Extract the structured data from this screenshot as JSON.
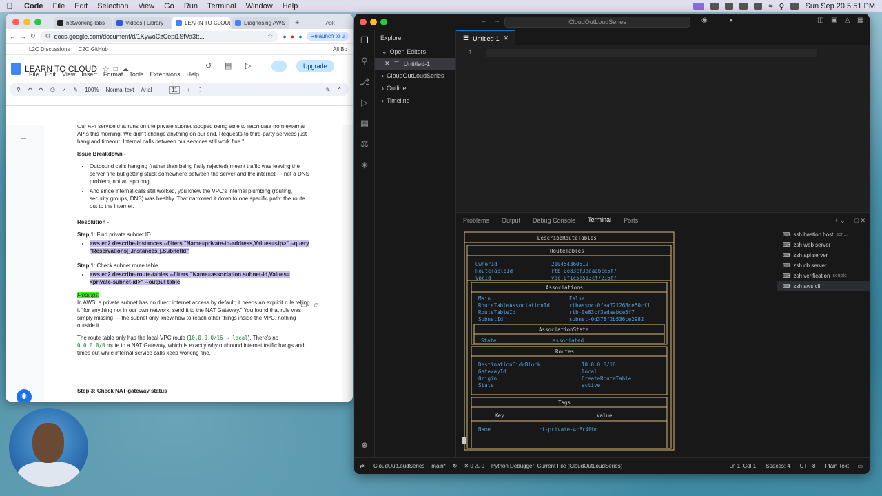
{
  "menubar": {
    "app": "Code",
    "items": [
      "File",
      "Edit",
      "Selection",
      "View",
      "Go",
      "Run",
      "Terminal",
      "Window",
      "Help"
    ],
    "clock": "Sun Sep 20  5:51 PM"
  },
  "chrome": {
    "tabs": [
      {
        "label": "networking-labs",
        "color": "#222222"
      },
      {
        "label": "Videos | Library",
        "color": "#2b5bd7"
      },
      {
        "label": "LEARN TO CLOUD",
        "color": "#4285f4"
      },
      {
        "label": "Diagnosing AWS",
        "color": "#4285f4"
      }
    ],
    "tab_extra": "Ask",
    "url": "docs.google.com/document/d/1KywoCzCepi1SfVa3tt...",
    "relaunch": "Relaunch to u",
    "all_bookmarks": "All Bo",
    "bookmarks": [
      "L2C Discussions",
      "C2C GitHub"
    ]
  },
  "docs": {
    "title": "LEARN TO CLOUD",
    "menus": [
      "File",
      "Edit",
      "View",
      "Insert",
      "Format",
      "Tools",
      "Extensions",
      "Help"
    ],
    "upgrade": "Upgrade",
    "zoom": "100%",
    "style": "Normal text",
    "font": "Arial",
    "font_size": "11",
    "intro": "Our API service that runs on the private subnet stopped being able to fetch data from external APIs this morning. We didn't change anything on our end. Requests to third-party services just hang and timeout. Internal calls between our services still work fine.\"",
    "breakdown_heading": "Issue Breakdown -",
    "bullets": [
      "Outbound calls hanging (rather than being flatly rejected) meant traffic was leaving the server fine but getting stuck somewhere between the server and the internet — not a DNS problem, not an app bug.",
      "And since internal calls still worked, you knew the VPC's internal plumbing (routing, security groups, DNS) was healthy. That narrowed it down to one specific path: the route out to the internet."
    ],
    "resolution_heading": "Resolution -",
    "step1_label": "Step 1",
    "step1_text": ": Find private subnet ID",
    "step1_cmd": "aws ec2 describe-instances --filters \"Name=private-ip-address,Values=<ip>\" --query \"Reservations[].Instances[].SubnetId\"",
    "step2_label": "Step 1",
    "step2_text": ": Check subnet route table",
    "step2_cmd": "aws ec2 describe-route-tables --filters \"Name=association.subnet-id,Values=<private-subnet-id>\" --output table",
    "findings_label": "Findings:",
    "findings_text": "In AWS, a private subnet has no direct internet access by default; it needs an explicit rule telling it \"for anything not in our own network, send it to the NAT Gateway.\" You found that rule was simply missing — the subnet only knew how to reach other things inside the VPC, nothing outside it.",
    "route_p1": "The route table only has the local VPC route (",
    "route_code1": "10.0.0.0/16 → local",
    "route_p2": "). There's no",
    "route_code2": "0.0.0.0/0",
    "route_p3": " route to a NAT Gateway, which is exactly why outbound internet traffic hangs and times out while internal service calls keep working fine.",
    "step3_partial": "Step 3: Check NAT gateway status"
  },
  "vscode": {
    "search": "CloudOutLoudSeries",
    "explorer": "Explorer",
    "open_editors": "Open Editors",
    "open_file": "Untitled-1",
    "folder": "CloudOutLoudSeries",
    "outline": "Outline",
    "timeline": "Timeline",
    "tab": "Untitled-1",
    "line_no": "1",
    "panel_tabs": [
      "Problems",
      "Output",
      "Debug Console",
      "Terminal",
      "Ports"
    ],
    "terminals": [
      {
        "name": "ssh bastion host",
        "sub": "scri..."
      },
      {
        "name": "zsh web server",
        "sub": ""
      },
      {
        "name": "zsh api server",
        "sub": ""
      },
      {
        "name": "zsh db server",
        "sub": ""
      },
      {
        "name": "zsh verification",
        "sub": "scripts"
      },
      {
        "name": "zsh aws cli",
        "sub": ""
      }
    ],
    "terminal_output": {
      "header": "DescribeRouteTables",
      "route_tables": "RouteTables",
      "owner_label": "OwnerId",
      "owner_val": "210454360512",
      "rtid_label": "RouteTableId",
      "rtid_val": "rtb-0e83cf3adaabce5f7",
      "vpc_label": "VpcId",
      "vpc_val": "vpc-0f1c5a513cf7216f7",
      "associations": "Associations",
      "main_label": "Main",
      "main_val": "False",
      "assoc_label": "RouteTableAssociationId",
      "assoc_val": "rtbassoc-0faa721268ce50cf1",
      "rt2_label": "RouteTableId",
      "rt2_val": "rtb-0e83cf3adaabce5f7",
      "subnet_label": "SubnetId",
      "subnet_val": "subnet-0d378f2b536ce2982",
      "assoc_state": "AssociationState",
      "state_label": "State",
      "state_val": "associated",
      "routes": "Routes",
      "dest_label": "DestinationCidrBlock",
      "dest_val": "10.0.0.0/16",
      "gw_label": "GatewayId",
      "gw_val": "local",
      "origin_label": "Origin",
      "origin_val": "CreateRouteTable",
      "rstate_label": "State",
      "rstate_val": "active",
      "tags": "Tags",
      "key_h": "Key",
      "value_h": "Value",
      "name_label": "Name",
      "name_val": "rt-private-4c8c40bd"
    },
    "status": {
      "folder": "CloudOutLoudSeries",
      "branch": "main*",
      "problems": "0",
      "warnings": "0",
      "debugger": "Python Debugger: Current File (CloudOutLoudSeries)",
      "position": "Ln 1, Col 1",
      "spaces": "Spaces: 4",
      "encoding": "UTF-8",
      "lang": "Plain Text"
    }
  }
}
